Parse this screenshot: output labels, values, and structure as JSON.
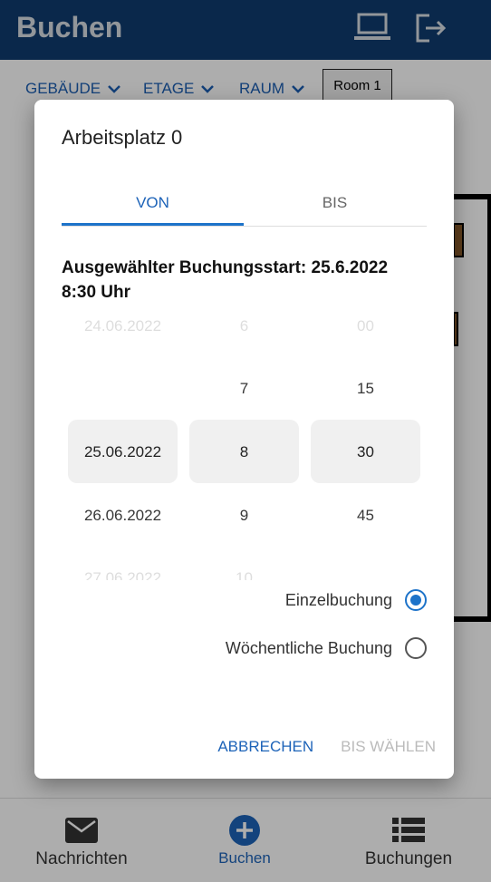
{
  "appbar": {
    "title": "Buchen"
  },
  "filters": {
    "building_label": "GEBÄUDE",
    "floor_label": "ETAGE",
    "room_label": "RAUM",
    "room_value": "Room 1"
  },
  "dialog": {
    "title": "Arbeitsplatz 0",
    "tabs": [
      {
        "label": "VON"
      },
      {
        "label": "BIS"
      }
    ],
    "selected_start": "Ausgewählter Buchungsstart: 25.6.2022 8:30 Uhr",
    "picker": {
      "dates": [
        "24.06.2022",
        "",
        "25.06.2022",
        "26.06.2022",
        "27.06.2022"
      ],
      "hours": [
        "6",
        "7",
        "8",
        "9",
        "10"
      ],
      "minutes": [
        "00",
        "15",
        "30",
        "45",
        ""
      ]
    },
    "options": {
      "single_label": "Einzelbuchung",
      "weekly_label": "Wöchentliche Buchung"
    },
    "actions": {
      "cancel_label": "ABBRECHEN",
      "choose_end_label": "BIS WÄHLEN"
    }
  },
  "bottom_nav": [
    {
      "label": "Nachrichten"
    },
    {
      "label": "Buchen"
    },
    {
      "label": "Buchungen"
    }
  ],
  "colors": {
    "primary": "#0f3b6f",
    "accent": "#1d73c9"
  }
}
